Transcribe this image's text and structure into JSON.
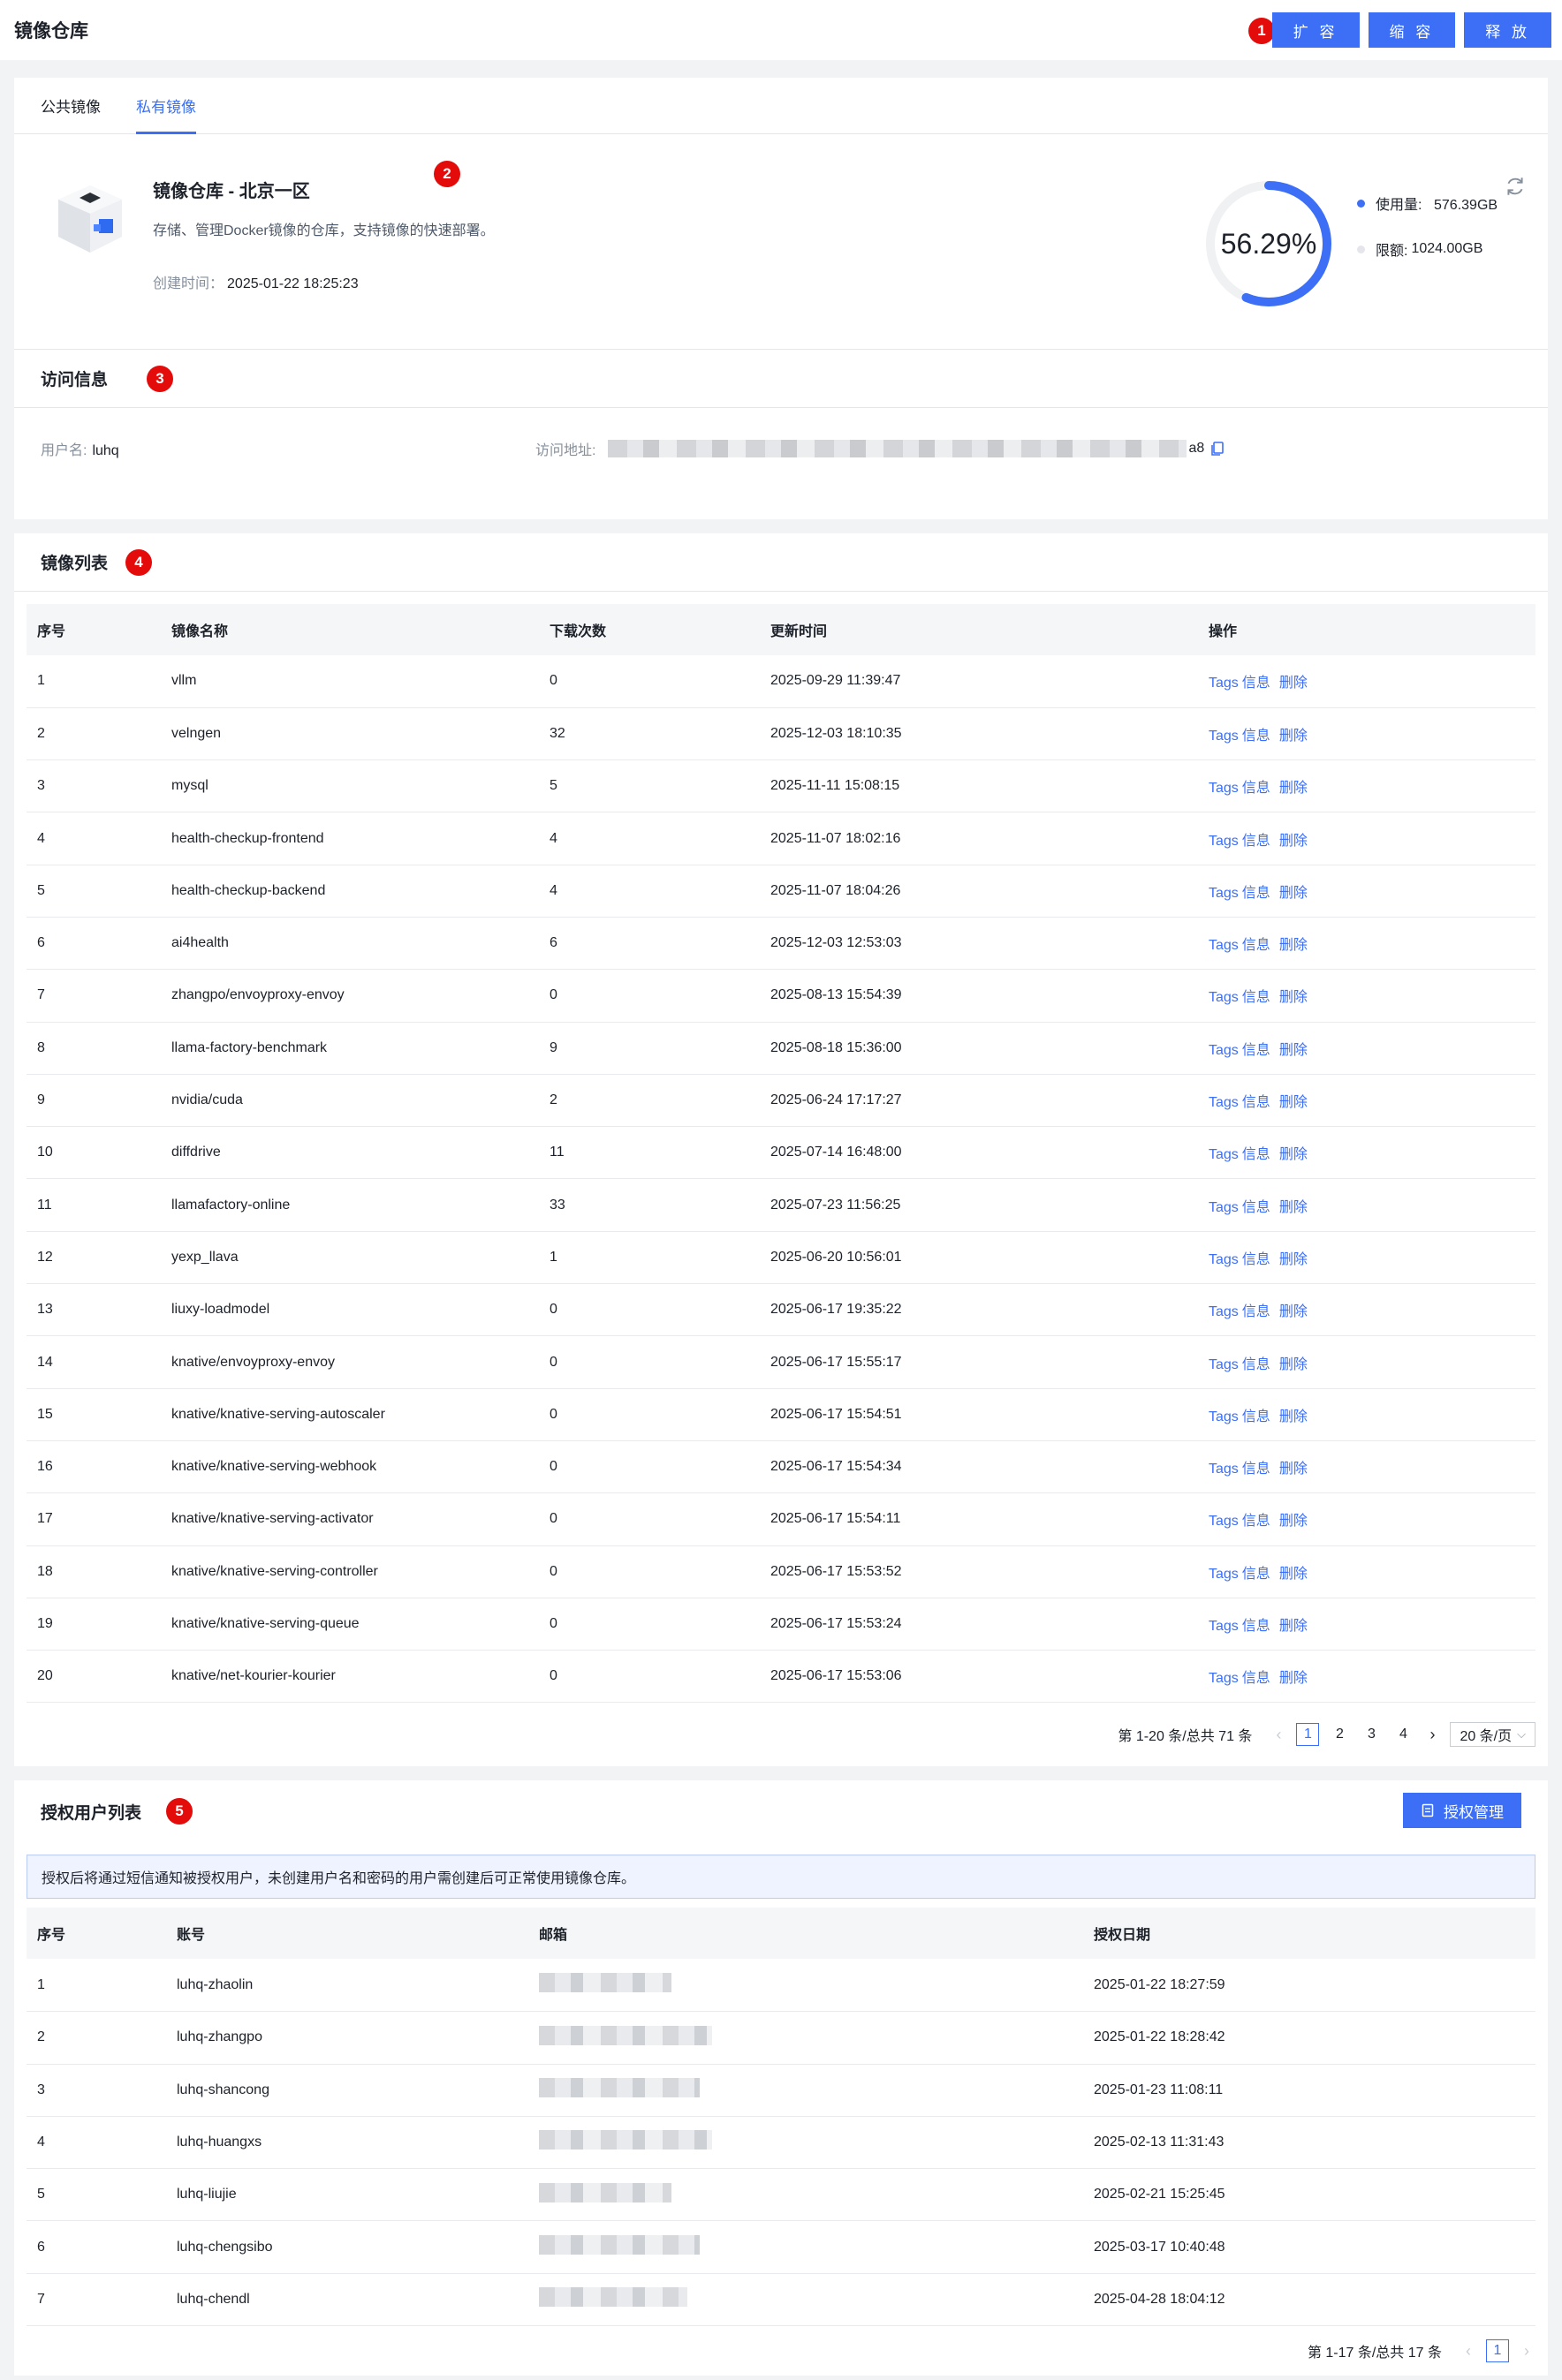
{
  "header": {
    "title": "镜像仓库",
    "buttons": {
      "expand": "扩 容",
      "shrink": "缩 容",
      "release": "释 放"
    }
  },
  "markers": {
    "m1": "1",
    "m2": "2",
    "m3": "3",
    "m4": "4",
    "m5": "5"
  },
  "tabs": [
    {
      "label": "公共镜像",
      "active": false
    },
    {
      "label": "私有镜像",
      "active": true
    }
  ],
  "repo": {
    "name": "镜像仓库 - 北京一区",
    "description": "存储、管理Docker镜像的仓库，支持镜像的快速部署。",
    "created_label": "创建时间：",
    "created_value": "2025-01-22 18:25:23",
    "usage_percent_label": "56.29%",
    "usage_fraction": 0.5629,
    "used_label": "使用量:",
    "used_value": "576.39GB",
    "limit_label": "限额:",
    "limit_value": "1024.00GB",
    "colors": {
      "accent": "#3c6ff5",
      "track": "#f0f1f3",
      "limit_dot": "#e5e6eb"
    }
  },
  "access": {
    "title": "访问信息",
    "username_label": "用户名:",
    "username_value": "luhq",
    "address_label": "访问地址:",
    "address_tail": "a8"
  },
  "images": {
    "title": "镜像列表",
    "columns": [
      "序号",
      "镜像名称",
      "下载次数",
      "更新时间",
      "操作"
    ],
    "op_labels": {
      "tags": "Tags",
      "info": "信息",
      "delete": "删除"
    },
    "rows": [
      [
        "1",
        "vllm",
        "0",
        "2025-09-29 11:39:47"
      ],
      [
        "2",
        "velngen",
        "32",
        "2025-12-03 18:10:35"
      ],
      [
        "3",
        "mysql",
        "5",
        "2025-11-11 15:08:15"
      ],
      [
        "4",
        "health-checkup-frontend",
        "4",
        "2025-11-07 18:02:16"
      ],
      [
        "5",
        "health-checkup-backend",
        "4",
        "2025-11-07 18:04:26"
      ],
      [
        "6",
        "ai4health",
        "6",
        "2025-12-03 12:53:03"
      ],
      [
        "7",
        "zhangpo/envoyproxy-envoy",
        "0",
        "2025-08-13 15:54:39"
      ],
      [
        "8",
        "llama-factory-benchmark",
        "9",
        "2025-08-18 15:36:00"
      ],
      [
        "9",
        "nvidia/cuda",
        "2",
        "2025-06-24 17:17:27"
      ],
      [
        "10",
        "diffdrive",
        "11",
        "2025-07-14 16:48:00"
      ],
      [
        "11",
        "llamafactory-online",
        "33",
        "2025-07-23 11:56:25"
      ],
      [
        "12",
        "yexp_llava",
        "1",
        "2025-06-20 10:56:01"
      ],
      [
        "13",
        "liuxy-loadmodel",
        "0",
        "2025-06-17 19:35:22"
      ],
      [
        "14",
        "knative/envoyproxy-envoy",
        "0",
        "2025-06-17 15:55:17"
      ],
      [
        "15",
        "knative/knative-serving-autoscaler",
        "0",
        "2025-06-17 15:54:51"
      ],
      [
        "16",
        "knative/knative-serving-webhook",
        "0",
        "2025-06-17 15:54:34"
      ],
      [
        "17",
        "knative/knative-serving-activator",
        "0",
        "2025-06-17 15:54:11"
      ],
      [
        "18",
        "knative/knative-serving-controller",
        "0",
        "2025-06-17 15:53:52"
      ],
      [
        "19",
        "knative/knative-serving-queue",
        "0",
        "2025-06-17 15:53:24"
      ],
      [
        "20",
        "knative/net-kourier-kourier",
        "0",
        "2025-06-17 15:53:06"
      ]
    ],
    "pager": {
      "summary": "第 1-20 条/总共 71 条",
      "pages": [
        "1",
        "2",
        "3",
        "4"
      ],
      "current": "1",
      "page_size": "20 条/页"
    }
  },
  "auth": {
    "title": "授权用户列表",
    "manage_button": "授权管理",
    "notice": "授权后将通过短信通知被授权用户，未创建用户名和密码的用户需创建后可正常使用镜像仓库。",
    "columns": [
      "序号",
      "账号",
      "邮箱",
      "授权日期"
    ],
    "rows": [
      [
        "1",
        "luhq-zhaolin",
        "2025-01-22 18:27:59"
      ],
      [
        "2",
        "luhq-zhangpo",
        "2025-01-22 18:28:42"
      ],
      [
        "3",
        "luhq-shancong",
        "2025-01-23 11:08:11"
      ],
      [
        "4",
        "luhq-huangxs",
        "2025-02-13 11:31:43"
      ],
      [
        "5",
        "luhq-liujie",
        "2025-02-21 15:25:45"
      ],
      [
        "6",
        "luhq-chengsibo",
        "2025-03-17 10:40:48"
      ],
      [
        "7",
        "luhq-chendl",
        "2025-04-28 18:04:12"
      ]
    ],
    "pager": {
      "summary": "第 1-17 条/总共 17 条",
      "current": "1"
    }
  }
}
